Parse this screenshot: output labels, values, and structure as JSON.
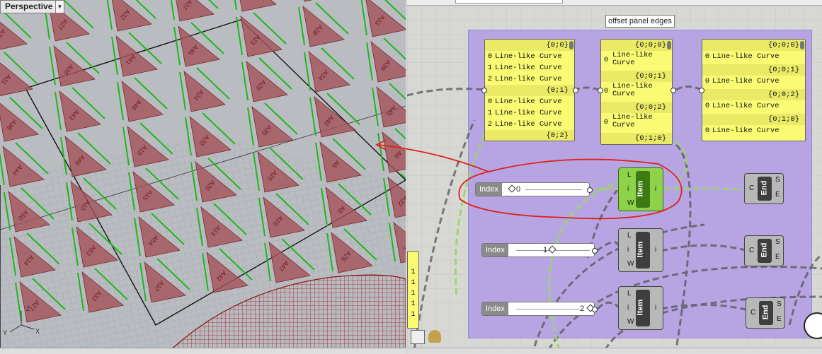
{
  "viewport": {
    "name": "Perspective",
    "axes": {
      "x": "X",
      "y": "Y",
      "z": "Z"
    },
    "panel_labels": [
      "A22",
      "A27",
      "A32",
      "A37",
      "A42",
      "A47",
      "A26",
      "A31",
      "A36",
      "A41",
      "A46",
      "A23",
      "A28",
      "A33",
      "A38",
      "A43",
      "A48",
      "A24",
      "A29",
      "A34",
      "A39",
      "A44",
      "A49",
      "A19",
      "A30",
      "A35",
      "A40",
      "A45",
      "A50",
      "A10",
      "A15",
      "A20",
      "A25",
      "A5",
      "A9",
      "A14",
      "A53",
      "A54",
      "A13",
      "A18",
      "A8"
    ]
  },
  "grasshopper": {
    "group_label": "offset panel edges",
    "panel_left": {
      "branches": [
        {
          "path": "{0;0}",
          "items": [
            "Line-like Curve",
            "Line-like Curve",
            "Line-like Curve"
          ]
        },
        {
          "path": "{0;1}",
          "items": [
            "Line-like Curve",
            "Line-like Curve",
            "Line-like Curve"
          ]
        }
      ],
      "tail": "{0;2}"
    },
    "panel_mid": {
      "branches": [
        {
          "path": "{0;0;0}",
          "items": [
            "Line-like\nCurve"
          ]
        },
        {
          "path": "{0;0;1}",
          "items": [
            "Line-like\nCurve"
          ]
        },
        {
          "path": "{0;0;2}",
          "items": [
            "Line-like\nCurve"
          ]
        }
      ],
      "tail": "{0;1;0}"
    },
    "panel_right": {
      "branches": [
        {
          "path": "{0;0;0}",
          "items": [
            "Line-like Curve"
          ]
        },
        {
          "path": "{0;0;1}",
          "items": [
            "Line-like Curve"
          ]
        },
        {
          "path": "{0;0;2}",
          "items": [
            "Line-like Curve"
          ]
        },
        {
          "path": "{0;1;0}",
          "items": [
            "Line-like Curve"
          ]
        }
      ]
    },
    "sliders": [
      {
        "name": "Index",
        "value": "0"
      },
      {
        "name": "Index",
        "value": "1"
      },
      {
        "name": "Index",
        "value": "2"
      }
    ],
    "item_components": [
      {
        "title": "Item",
        "inputs": [
          "L",
          "i",
          "W"
        ],
        "output": "i"
      },
      {
        "title": "Item",
        "inputs": [
          "L",
          "i",
          "W"
        ],
        "output": "i"
      },
      {
        "title": "Item",
        "inputs": [
          "L",
          "i",
          "W"
        ],
        "output": "i"
      }
    ],
    "end_components": [
      {
        "title": "End",
        "input": "C",
        "outputs": [
          "S",
          "E"
        ]
      },
      {
        "title": "End",
        "input": "C",
        "outputs": [
          "S",
          "E"
        ]
      },
      {
        "title": "End",
        "input": "C",
        "outputs": [
          "S",
          "E"
        ]
      }
    ],
    "side_panel_values": [
      "1",
      "1",
      "1",
      "1",
      "1",
      "1",
      "1"
    ],
    "colors": {
      "group": "#b7a5e3",
      "panel": "#fafa73",
      "selected": "#8ed24a",
      "annotation": "#e0201a"
    }
  }
}
